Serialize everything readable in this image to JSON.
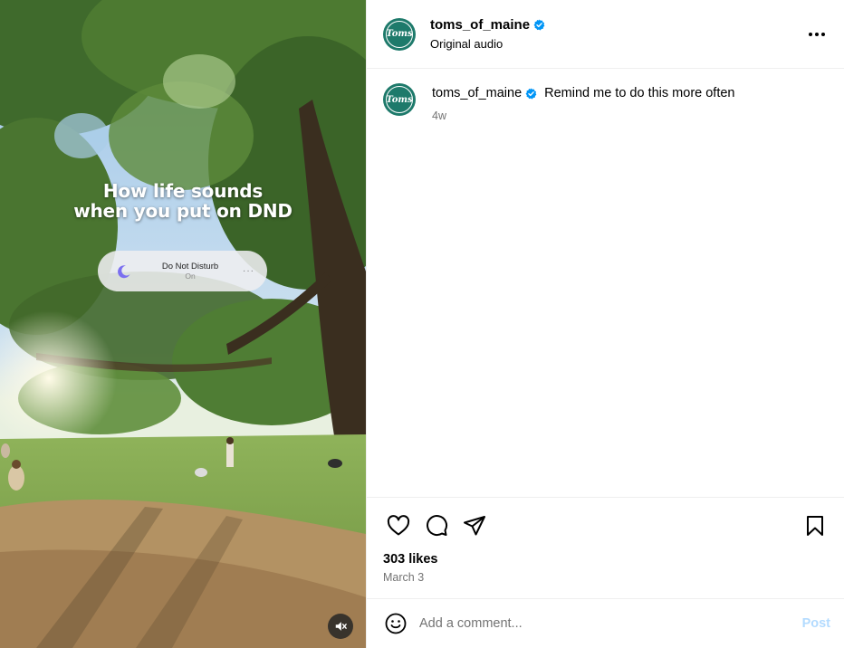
{
  "media": {
    "overlay_line1": "How life sounds",
    "overlay_line2": "when you put on DND",
    "dnd_title": "Do Not Disturb",
    "dnd_status": "On",
    "dnd_more": "···",
    "mute_icon": "speaker-muted-icon"
  },
  "header": {
    "avatar_text": "Toms",
    "username": "toms_of_maine",
    "verified": true,
    "audio": "Original audio",
    "more_icon": "more-horizontal-icon"
  },
  "caption": {
    "username": "toms_of_maine",
    "text": "Remind me to do this more often",
    "time": "4w"
  },
  "actions": {
    "icons": [
      "heart-icon",
      "comment-icon",
      "share-icon",
      "bookmark-icon"
    ],
    "likes": "303 likes",
    "date": "March 3"
  },
  "comment_box": {
    "placeholder": "Add a comment...",
    "post_label": "Post"
  },
  "colors": {
    "avatar_bg": "#1e7a6b",
    "verified": "#0095f6",
    "post_disabled": "#b3dbff",
    "muted_text": "#737373"
  }
}
